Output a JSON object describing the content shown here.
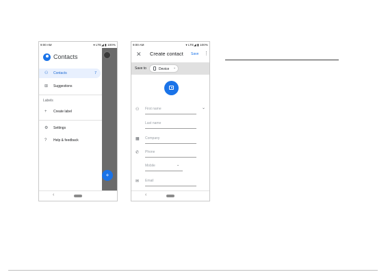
{
  "status": {
    "time": "9:00 AM",
    "battery": "100%"
  },
  "drawer": {
    "title": "Contacts",
    "items": [
      {
        "icon": "person-icon",
        "glyph": "⚇",
        "label": "Contacts",
        "count": "7"
      },
      {
        "icon": "suggestions-icon",
        "glyph": "⊞",
        "label": "Suggestions"
      }
    ],
    "labels_header": "Labels",
    "create_label": {
      "icon": "plus-icon",
      "glyph": "+",
      "label": "Create label"
    },
    "settings": {
      "icon": "gear-icon",
      "glyph": "⚙",
      "label": "Settings"
    },
    "help": {
      "icon": "help-icon",
      "glyph": "?",
      "label": "Help & feedback"
    }
  },
  "fab": {
    "glyph": "+"
  },
  "nav": {
    "back": "‹"
  },
  "create": {
    "close": "✕",
    "title": "Create contact",
    "save": "Save",
    "more": "⋮",
    "save_to_label": "Save to",
    "save_to_value": "Device",
    "chevron": "⌄",
    "fields": {
      "first_name": "First name",
      "last_name": "Last name",
      "company": "Company",
      "phone": "Phone",
      "phone_type": "Mobile",
      "email": "Email"
    },
    "icons": {
      "person": "⚇",
      "company": "▦",
      "phone": "✆",
      "email": "✉",
      "expand": "⌄"
    }
  },
  "colors": {
    "accent": "#1a73e8",
    "active_bg": "#e8f0fe",
    "scrim": "#6b6b6b",
    "save_bar": "#e0e0e0"
  }
}
